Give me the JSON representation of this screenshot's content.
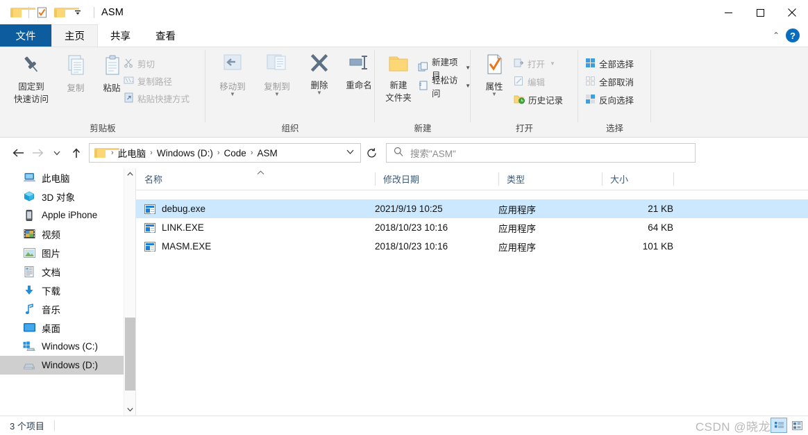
{
  "window": {
    "title": "ASM",
    "quick_access": [
      {
        "name": "folder-icon",
        "label": "folder"
      },
      {
        "name": "properties-icon",
        "label": "properties"
      },
      {
        "name": "new-folder-icon",
        "label": "new folder"
      },
      {
        "name": "customize-dropdown-icon",
        "label": "customize"
      }
    ],
    "controls": {
      "minimize": "minimize",
      "maximize": "maximize",
      "close": "close"
    }
  },
  "ribbon": {
    "tabs": [
      {
        "label": "文件",
        "style": "file"
      },
      {
        "label": "主页",
        "style": "active"
      },
      {
        "label": "共享",
        "style": "normal"
      },
      {
        "label": "查看",
        "style": "normal"
      }
    ],
    "collapse_icon": "⌃",
    "help_label": "?",
    "groups": [
      {
        "label": "剪贴板",
        "big": [
          {
            "label_line1": "固定到",
            "label_line2": "快速访问",
            "icon": "pin-icon",
            "dim": false
          },
          {
            "label_line1": "复制",
            "label_line2": "",
            "icon": "copy-icon",
            "dim": true
          },
          {
            "label_line1": "粘贴",
            "label_line2": "",
            "icon": "paste-icon",
            "dim": false
          }
        ],
        "small": [
          {
            "label": "剪切",
            "icon": "scissors-icon",
            "dim": true
          },
          {
            "label": "复制路径",
            "icon": "copy-path-icon",
            "dim": true
          },
          {
            "label": "粘贴快捷方式",
            "icon": "paste-shortcut-icon",
            "dim": true
          }
        ]
      },
      {
        "label": "组织",
        "big": [
          {
            "label_line1": "移动到",
            "label_line2": "",
            "icon": "move-to-icon",
            "dim": true,
            "caret": true
          },
          {
            "label_line1": "复制到",
            "label_line2": "",
            "icon": "copy-to-icon",
            "dim": true,
            "caret": true
          },
          {
            "label_line1": "删除",
            "label_line2": "",
            "icon": "delete-icon",
            "dim": false,
            "caret": true
          },
          {
            "label_line1": "重命名",
            "label_line2": "",
            "icon": "rename-icon",
            "dim": false
          }
        ]
      },
      {
        "label": "新建",
        "big": [
          {
            "label_line1": "新建",
            "label_line2": "文件夹",
            "icon": "new-folder-icon",
            "dim": false
          }
        ],
        "small": [
          {
            "label": "新建项目",
            "icon": "new-item-icon",
            "dim": false,
            "caret": true
          },
          {
            "label": "轻松访问",
            "icon": "easy-access-icon",
            "dim": false,
            "caret": true
          }
        ]
      },
      {
        "label": "打开",
        "big": [
          {
            "label_line1": "属性",
            "label_line2": "",
            "icon": "properties-icon",
            "dim": false,
            "caret": true
          }
        ],
        "small": [
          {
            "label": "打开",
            "icon": "open-icon",
            "dim": true,
            "caret": true
          },
          {
            "label": "编辑",
            "icon": "edit-icon",
            "dim": true
          },
          {
            "label": "历史记录",
            "icon": "history-icon",
            "dim": false
          }
        ]
      },
      {
        "label": "选择",
        "small": [
          {
            "label": "全部选择",
            "icon": "select-all-icon",
            "dim": false
          },
          {
            "label": "全部取消",
            "icon": "select-none-icon",
            "dim": false
          },
          {
            "label": "反向选择",
            "icon": "invert-selection-icon",
            "dim": false
          }
        ]
      }
    ]
  },
  "address": {
    "back_icon": "←",
    "forward_icon": "→",
    "recent_icon": "⌄",
    "up_icon": "↑",
    "crumbs": [
      "此电脑",
      "Windows (D:)",
      "Code",
      "ASM"
    ],
    "separator": "›",
    "dropdown_icon": "⌄",
    "refresh_icon": "↻"
  },
  "search": {
    "placeholder": "搜索\"ASM\"",
    "icon": "search-icon"
  },
  "sidebar": {
    "items": [
      {
        "label": "此电脑",
        "icon": "computer-icon",
        "selected": false
      },
      {
        "label": "3D 对象",
        "icon": "3d-objects-icon",
        "selected": false
      },
      {
        "label": "Apple iPhone",
        "icon": "iphone-icon",
        "selected": false
      },
      {
        "label": "视频",
        "icon": "videos-icon",
        "selected": false
      },
      {
        "label": "图片",
        "icon": "pictures-icon",
        "selected": false
      },
      {
        "label": "文档",
        "icon": "documents-icon",
        "selected": false
      },
      {
        "label": "下载",
        "icon": "downloads-icon",
        "selected": false
      },
      {
        "label": "音乐",
        "icon": "music-icon",
        "selected": false
      },
      {
        "label": "桌面",
        "icon": "desktop-icon",
        "selected": false
      },
      {
        "label": "Windows (C:)",
        "icon": "drive-c-icon",
        "selected": false
      },
      {
        "label": "Windows (D:)",
        "icon": "drive-d-icon",
        "selected": true
      }
    ],
    "scroll_up_icon": "⌃",
    "scroll_down_icon": "⌄"
  },
  "filelist": {
    "columns": [
      {
        "label": "名称",
        "align": "left"
      },
      {
        "label": "修改日期",
        "align": "left"
      },
      {
        "label": "类型",
        "align": "left"
      },
      {
        "label": "大小",
        "align": "right"
      }
    ],
    "sort_indicator": "⌃",
    "rows": [
      {
        "name": "debug.exe",
        "date": "2021/9/19 10:25",
        "type": "应用程序",
        "size": "21 KB",
        "selected": true,
        "icon": "exe-file-icon"
      },
      {
        "name": "LINK.EXE",
        "date": "2018/10/23 10:16",
        "type": "应用程序",
        "size": "64 KB",
        "selected": false,
        "icon": "exe-file-icon"
      },
      {
        "name": "MASM.EXE",
        "date": "2018/10/23 10:16",
        "type": "应用程序",
        "size": "101 KB",
        "selected": false,
        "icon": "exe-file-icon"
      }
    ]
  },
  "status": {
    "item_count": "3 个项目",
    "watermark": "CSDN @晓龙",
    "view_details_icon": "details-view-icon",
    "view_large_icon": "large-icons-view-icon"
  },
  "colors": {
    "accent": "#0d5c9e",
    "selection": "#cce8ff",
    "ribbon_bg": "#f3f3f3",
    "header_text": "#3b5a78"
  }
}
